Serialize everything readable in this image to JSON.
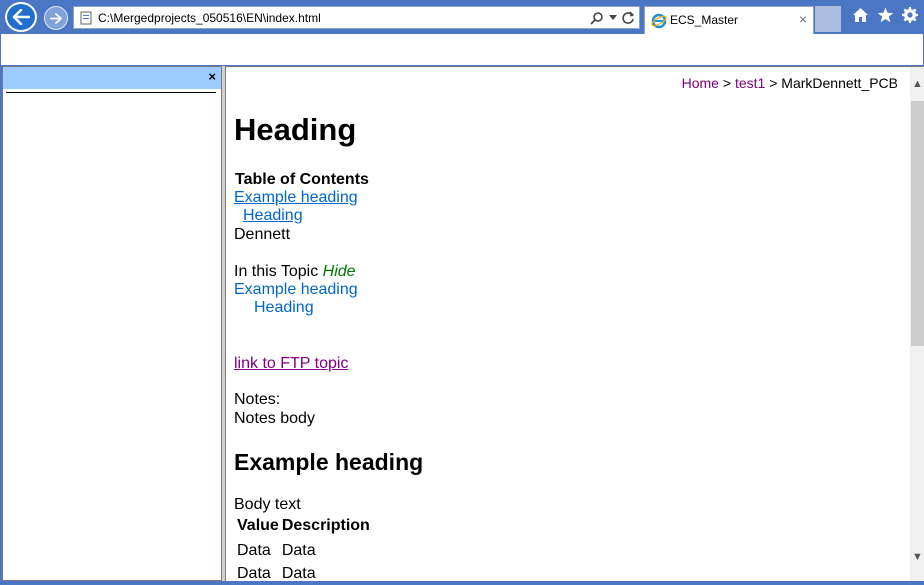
{
  "browser": {
    "address": "C:\\Mergedprojects_050516\\EN\\index.html",
    "tab_title": "ECS_Master",
    "tab_close": "×",
    "icons": [
      "back-arrow-icon",
      "forward-arrow-icon",
      "search-icon",
      "refresh-icon",
      "home-icon",
      "star-icon",
      "gear-icon"
    ],
    "accent_color": "#4a76c4"
  },
  "left_pane": {
    "close_glyph": "×",
    "header_color": "#9ecbff"
  },
  "breadcrumb": {
    "home": "Home",
    "sep1": " > ",
    "test1": "test1",
    "sep2": " > ",
    "current": "MarkDennett_PCB"
  },
  "content": {
    "title": "Heading",
    "toc_title": "Table of Contents",
    "toc_items": [
      "Example heading",
      "Heading"
    ],
    "toc_name": "Dennett",
    "in_this_topic": "In this Topic",
    "hide": "Hide",
    "topic_items": [
      "Example heading",
      "Heading"
    ],
    "ftp_link": "link to FTP topic",
    "notes_label": "Notes:",
    "notes_body": "Notes body",
    "section_heading": "Example heading",
    "body_text": "Body text",
    "table": {
      "headers": [
        "Value",
        "Description"
      ],
      "rows": [
        [
          "Data",
          "Data"
        ],
        [
          "Data",
          "Data"
        ]
      ]
    }
  }
}
